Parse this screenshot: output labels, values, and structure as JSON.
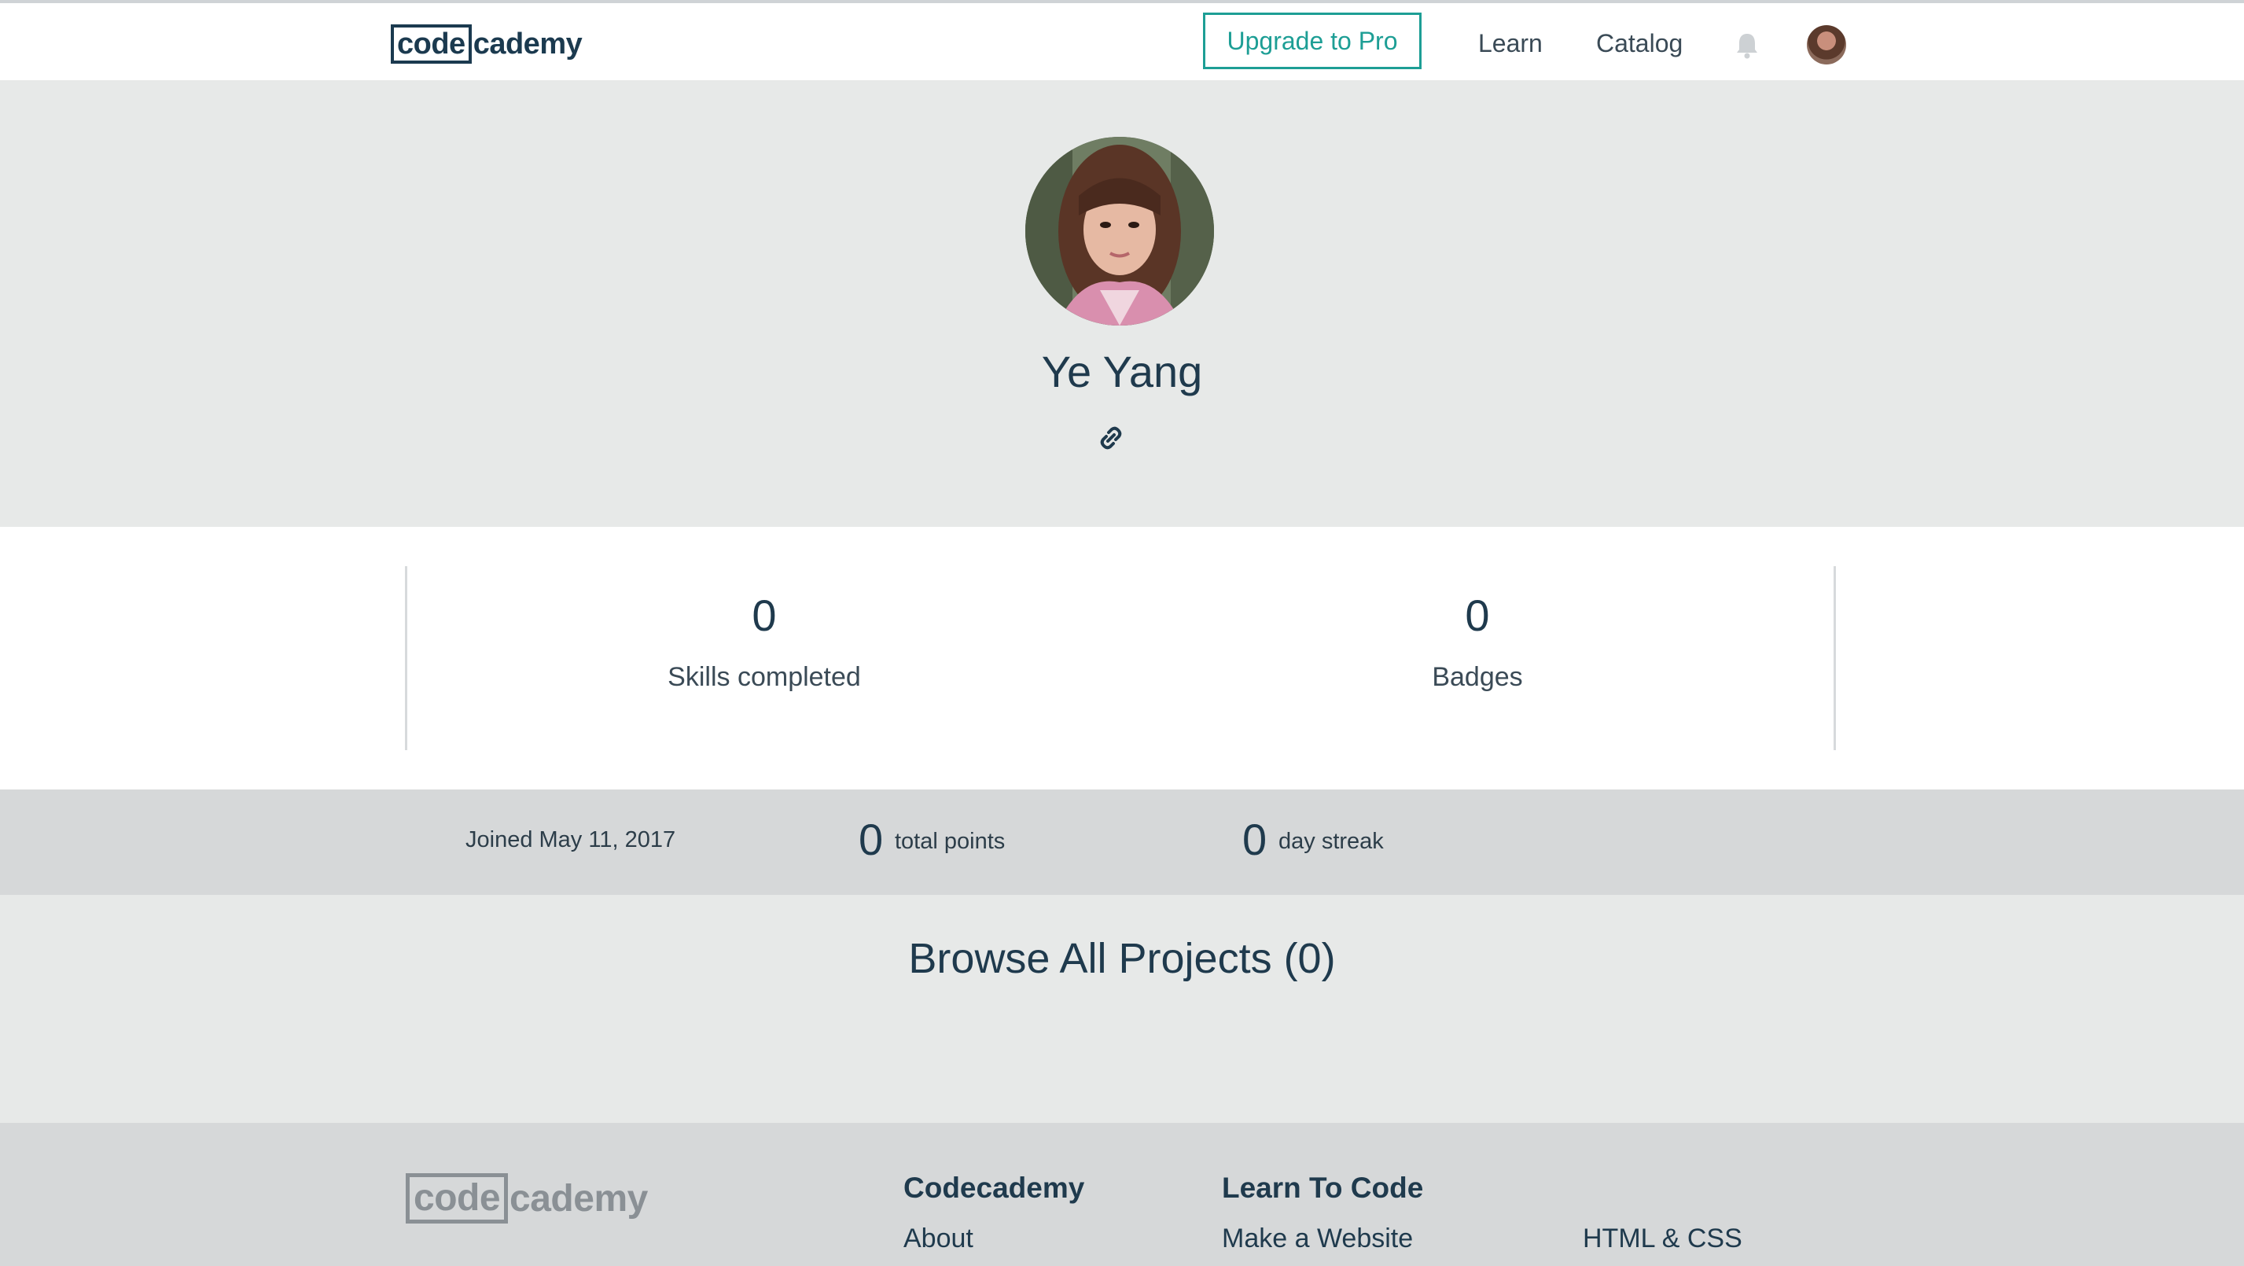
{
  "header": {
    "logo_box": "code",
    "logo_rest": "cademy",
    "upgrade_label": "Upgrade to Pro",
    "nav": [
      "Learn",
      "Catalog"
    ]
  },
  "profile": {
    "name": "Ye Yang"
  },
  "stats": [
    {
      "value": "0",
      "label": "Skills completed"
    },
    {
      "value": "0",
      "label": "Badges"
    }
  ],
  "info": {
    "joined": "Joined May 11, 2017",
    "points_value": "0",
    "points_label": "total points",
    "streak_value": "0",
    "streak_label": "day streak"
  },
  "projects": {
    "title": "Browse All Projects (0)"
  },
  "footer": {
    "logo_box": "code",
    "logo_rest": "cademy",
    "col1_heading": "Codecademy",
    "col1_link": "About",
    "col2_heading": "Learn To Code",
    "col2_link": "Make a Website",
    "col3_link": "HTML & CSS"
  },
  "colors": {
    "accent": "#1d9e95",
    "brand_dark": "#1b3a4f",
    "hero_bg": "#e7e9e8",
    "strip_bg": "#d6d8d9"
  },
  "icons": [
    "bell-icon",
    "link-icon",
    "avatar"
  ]
}
